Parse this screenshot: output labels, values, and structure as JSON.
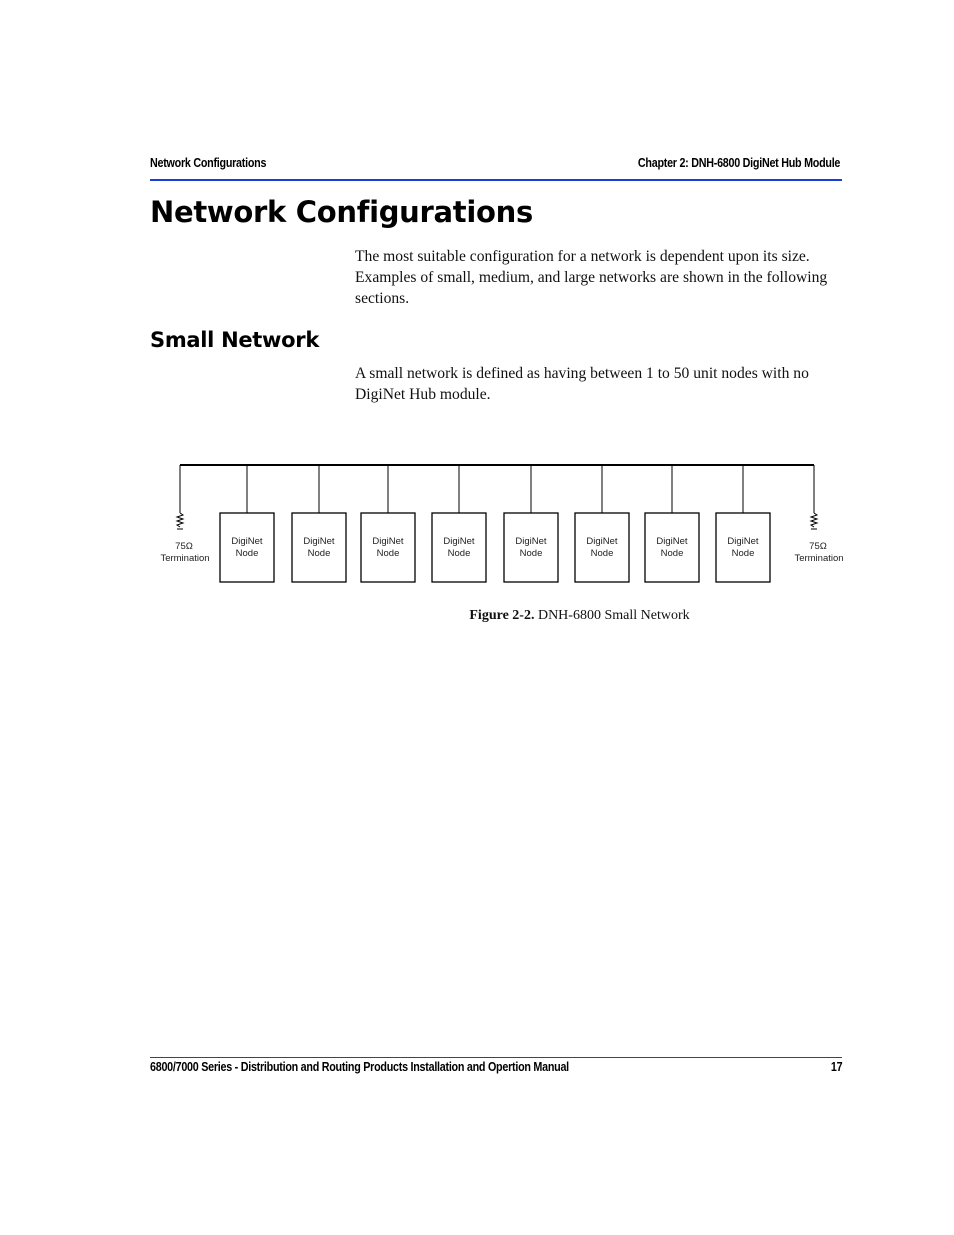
{
  "header": {
    "section": "Network Configurations",
    "chapter": "Chapter 2: DNH-6800 DigiNet Hub Module",
    "accent_color": "#1b3fd6"
  },
  "page_title": "Network Configurations",
  "intro_paragraph": "The most suitable configuration for a network is dependent upon its size. Examples of small, medium, and large networks are shown in the following sections.",
  "section": {
    "title": "Small Network",
    "paragraph": "A small network is defined as having between 1 to 50 unit nodes with no DigiNet Hub module."
  },
  "figure": {
    "caption_label": "Figure 2-2.",
    "caption_text": " DNH-6800 Small Network",
    "terminations": [
      {
        "value": "75Ω",
        "label": "Termination"
      },
      {
        "value": "75Ω",
        "label": "Termination"
      }
    ],
    "nodes": [
      {
        "line1": "DigiNet",
        "line2": "Node"
      },
      {
        "line1": "DigiNet",
        "line2": "Node"
      },
      {
        "line1": "DigiNet",
        "line2": "Node"
      },
      {
        "line1": "DigiNet",
        "line2": "Node"
      },
      {
        "line1": "DigiNet",
        "line2": "Node"
      },
      {
        "line1": "DigiNet",
        "line2": "Node"
      },
      {
        "line1": "DigiNet",
        "line2": "Node"
      },
      {
        "line1": "DigiNet",
        "line2": "Node"
      }
    ]
  },
  "footer": {
    "manual_title": "6800/7000 Series - Distribution and Routing Products Installation and Opertion Manual",
    "page_number": "17"
  }
}
